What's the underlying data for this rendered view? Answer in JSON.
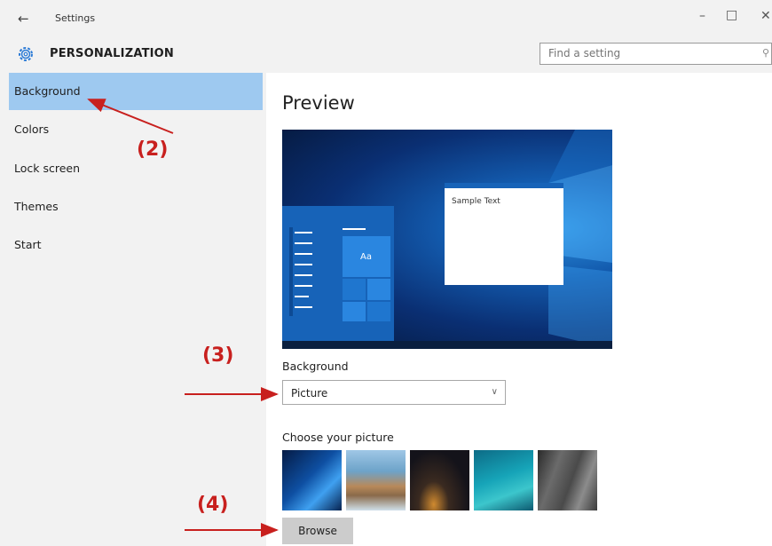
{
  "window": {
    "back_icon": "back-arrow-icon",
    "title": "Settings"
  },
  "header": {
    "section_title": "PERSONALIZATION",
    "search_placeholder": "Find a setting"
  },
  "sidebar": {
    "items": [
      {
        "label": "Background",
        "selected": true
      },
      {
        "label": "Colors"
      },
      {
        "label": "Lock screen"
      },
      {
        "label": "Themes"
      },
      {
        "label": "Start"
      }
    ]
  },
  "main": {
    "preview_title": "Preview",
    "preview_sample_text": "Sample Text",
    "preview_tile_text": "Aa",
    "background_label": "Background",
    "background_value": "Picture",
    "choose_picture_label": "Choose your picture",
    "browse_label": "Browse"
  },
  "annotations": {
    "step2": "(2)",
    "step3": "(3)",
    "step4": "(4)",
    "color": "#c8201e"
  },
  "colors": {
    "accent": "#1763b8",
    "selected_nav": "#9ec9f0"
  }
}
